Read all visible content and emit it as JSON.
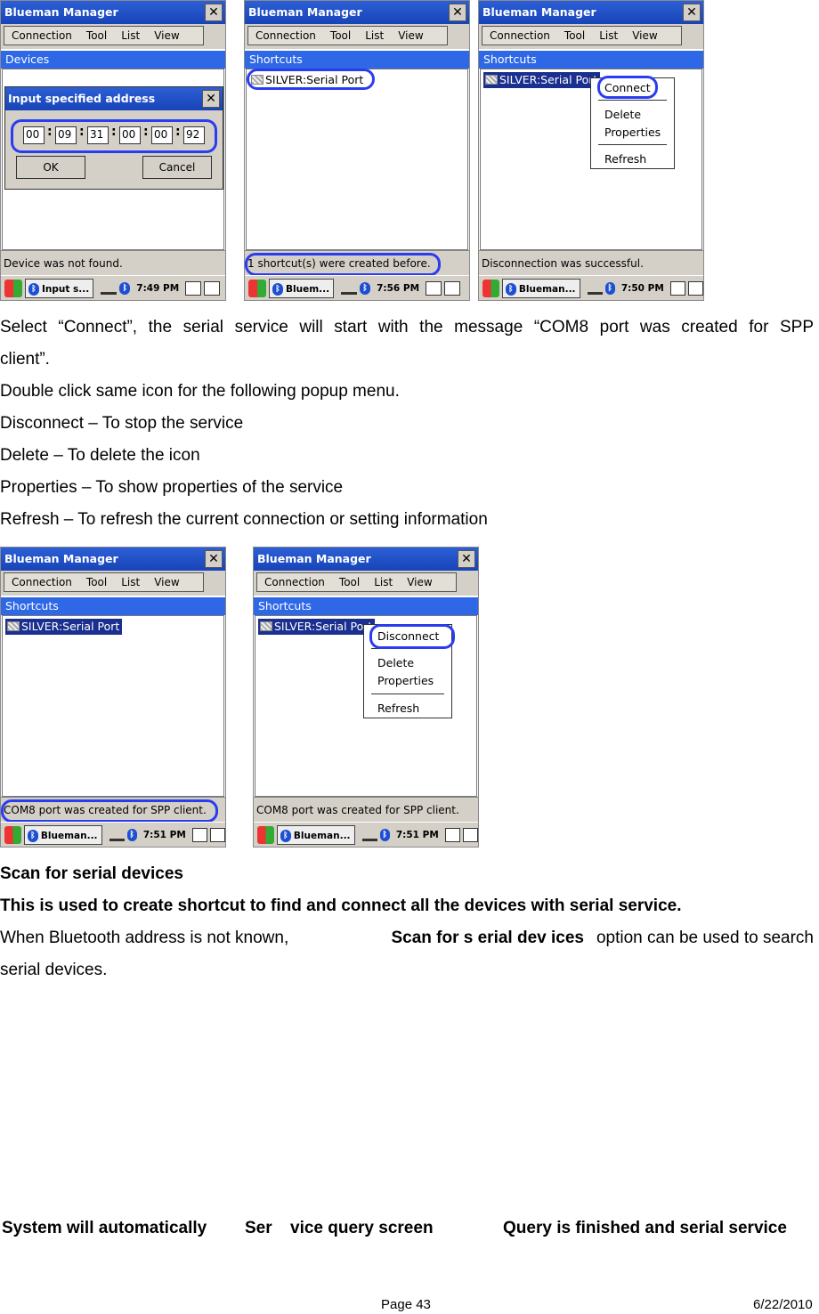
{
  "app": {
    "title": "Blueman Manager",
    "close": "✕",
    "menu": [
      "Connection",
      "Tool",
      "List",
      "View"
    ]
  },
  "screens": [
    {
      "section": "Devices",
      "status": "Device was not found.",
      "taskbar": {
        "app": "Input s...",
        "time": "7:49 PM"
      },
      "dialog": {
        "title": "Input specified address",
        "fields": [
          "00",
          "09",
          "31",
          "00",
          "00",
          "92"
        ],
        "ok": "OK",
        "cancel": "Cancel"
      }
    },
    {
      "section": "Shortcuts",
      "entry": "SILVER:Serial Port",
      "status": "1 shortcut(s) were created before.",
      "taskbar": {
        "app": "Bluem...",
        "time": "7:56 PM"
      }
    },
    {
      "section": "Shortcuts",
      "entry": "SILVER:Serial Port",
      "status": "Disconnection was successful.",
      "taskbar": {
        "app": "Blueman...",
        "time": "7:50 PM"
      },
      "popup": [
        "Connect",
        "Delete",
        "Properties",
        "Refresh"
      ]
    },
    {
      "section": "Shortcuts",
      "entry": "SILVER:Serial Port",
      "status": "COM8 port was created for  SPP client.",
      "taskbar": {
        "app": "Blueman...",
        "time": "7:51 PM"
      }
    },
    {
      "section": "Shortcuts",
      "entry": "SILVER:Serial Port",
      "status": "COM8 port was created for  SPP client.",
      "taskbar": {
        "app": "Blueman...",
        "time": "7:51 PM"
      },
      "popup": [
        "Disconnect",
        "Delete",
        "Properties",
        "Refresh"
      ]
    }
  ],
  "text": {
    "p1a": "Select “Connect”, the serial service will start with the message “COM8 port was created for SPP",
    "p1b": "client”.",
    "p2": "Double click same icon for the following popup menu.",
    "p3": "Disconnect – To stop the service",
    "p4": "Delete – To delete the icon",
    "p5": "Properties – To show properties of the service",
    "p6": "Refresh – To refresh the current connection or setting information",
    "h1": "Scan for serial devices",
    "h2": "This is used to create shortcut to find and connect all the devices with serial service.",
    "p7a": "When Bluetooth address is not known,",
    "p7b": "Scan for s erial dev ices",
    "p7c": "option can be used to search",
    "p7d": "serial devices.",
    "cap1": "System will automatically",
    "cap2": "Ser",
    "cap3": "vice query screen",
    "cap4": "Query is finished and serial service"
  },
  "footer": {
    "page": "Page 43",
    "date": "6/22/2010"
  }
}
